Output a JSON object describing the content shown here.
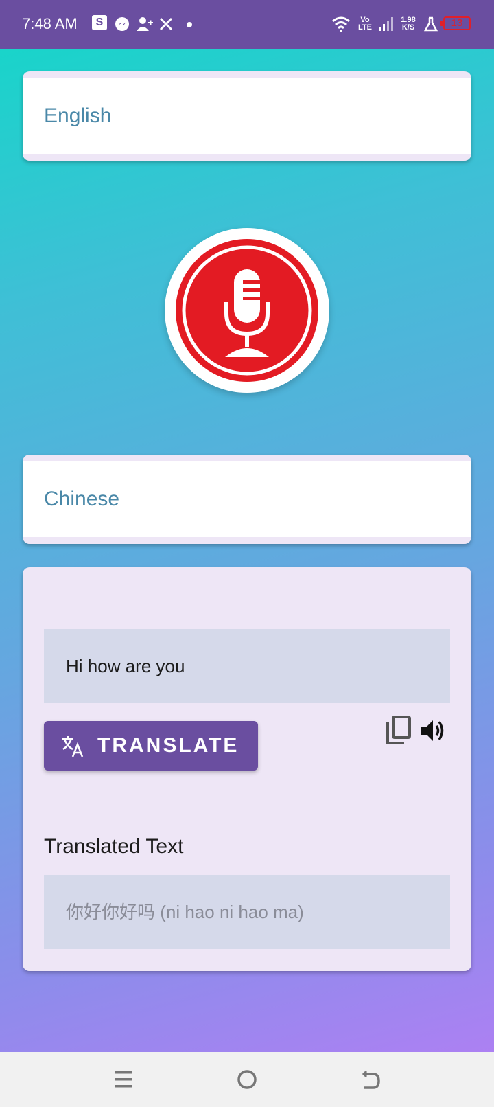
{
  "status_bar": {
    "time": "7:48 AM",
    "s_badge": "S",
    "network_vo": "Vo",
    "network_lte": "LTE",
    "speed_value": "1.98",
    "speed_unit": "K/S",
    "battery": "13",
    "icons": [
      "s-app-icon",
      "messenger-icon",
      "add-user-icon",
      "x-icon",
      "dot-icon",
      "wifi-icon",
      "volte-icon",
      "signal-icon",
      "speed-icon",
      "lab-icon",
      "battery-icon"
    ]
  },
  "source_language": {
    "label": "English"
  },
  "mic": {
    "icon": "microphone-icon",
    "color": "#e31b23"
  },
  "target_language": {
    "label": "Chinese"
  },
  "translator": {
    "input_text": "Hi how are you",
    "translate_button": "TRANSLATE",
    "translated_title": "Translated Text",
    "output_text": "你好你好吗 (ni hao ni hao ma)"
  },
  "nav_bar": {
    "icons": [
      "menu-icon",
      "home-icon",
      "back-icon"
    ]
  },
  "colors": {
    "accent": "#6a4ea0",
    "mic_red": "#e31b23",
    "language_text": "#4a88a8"
  }
}
